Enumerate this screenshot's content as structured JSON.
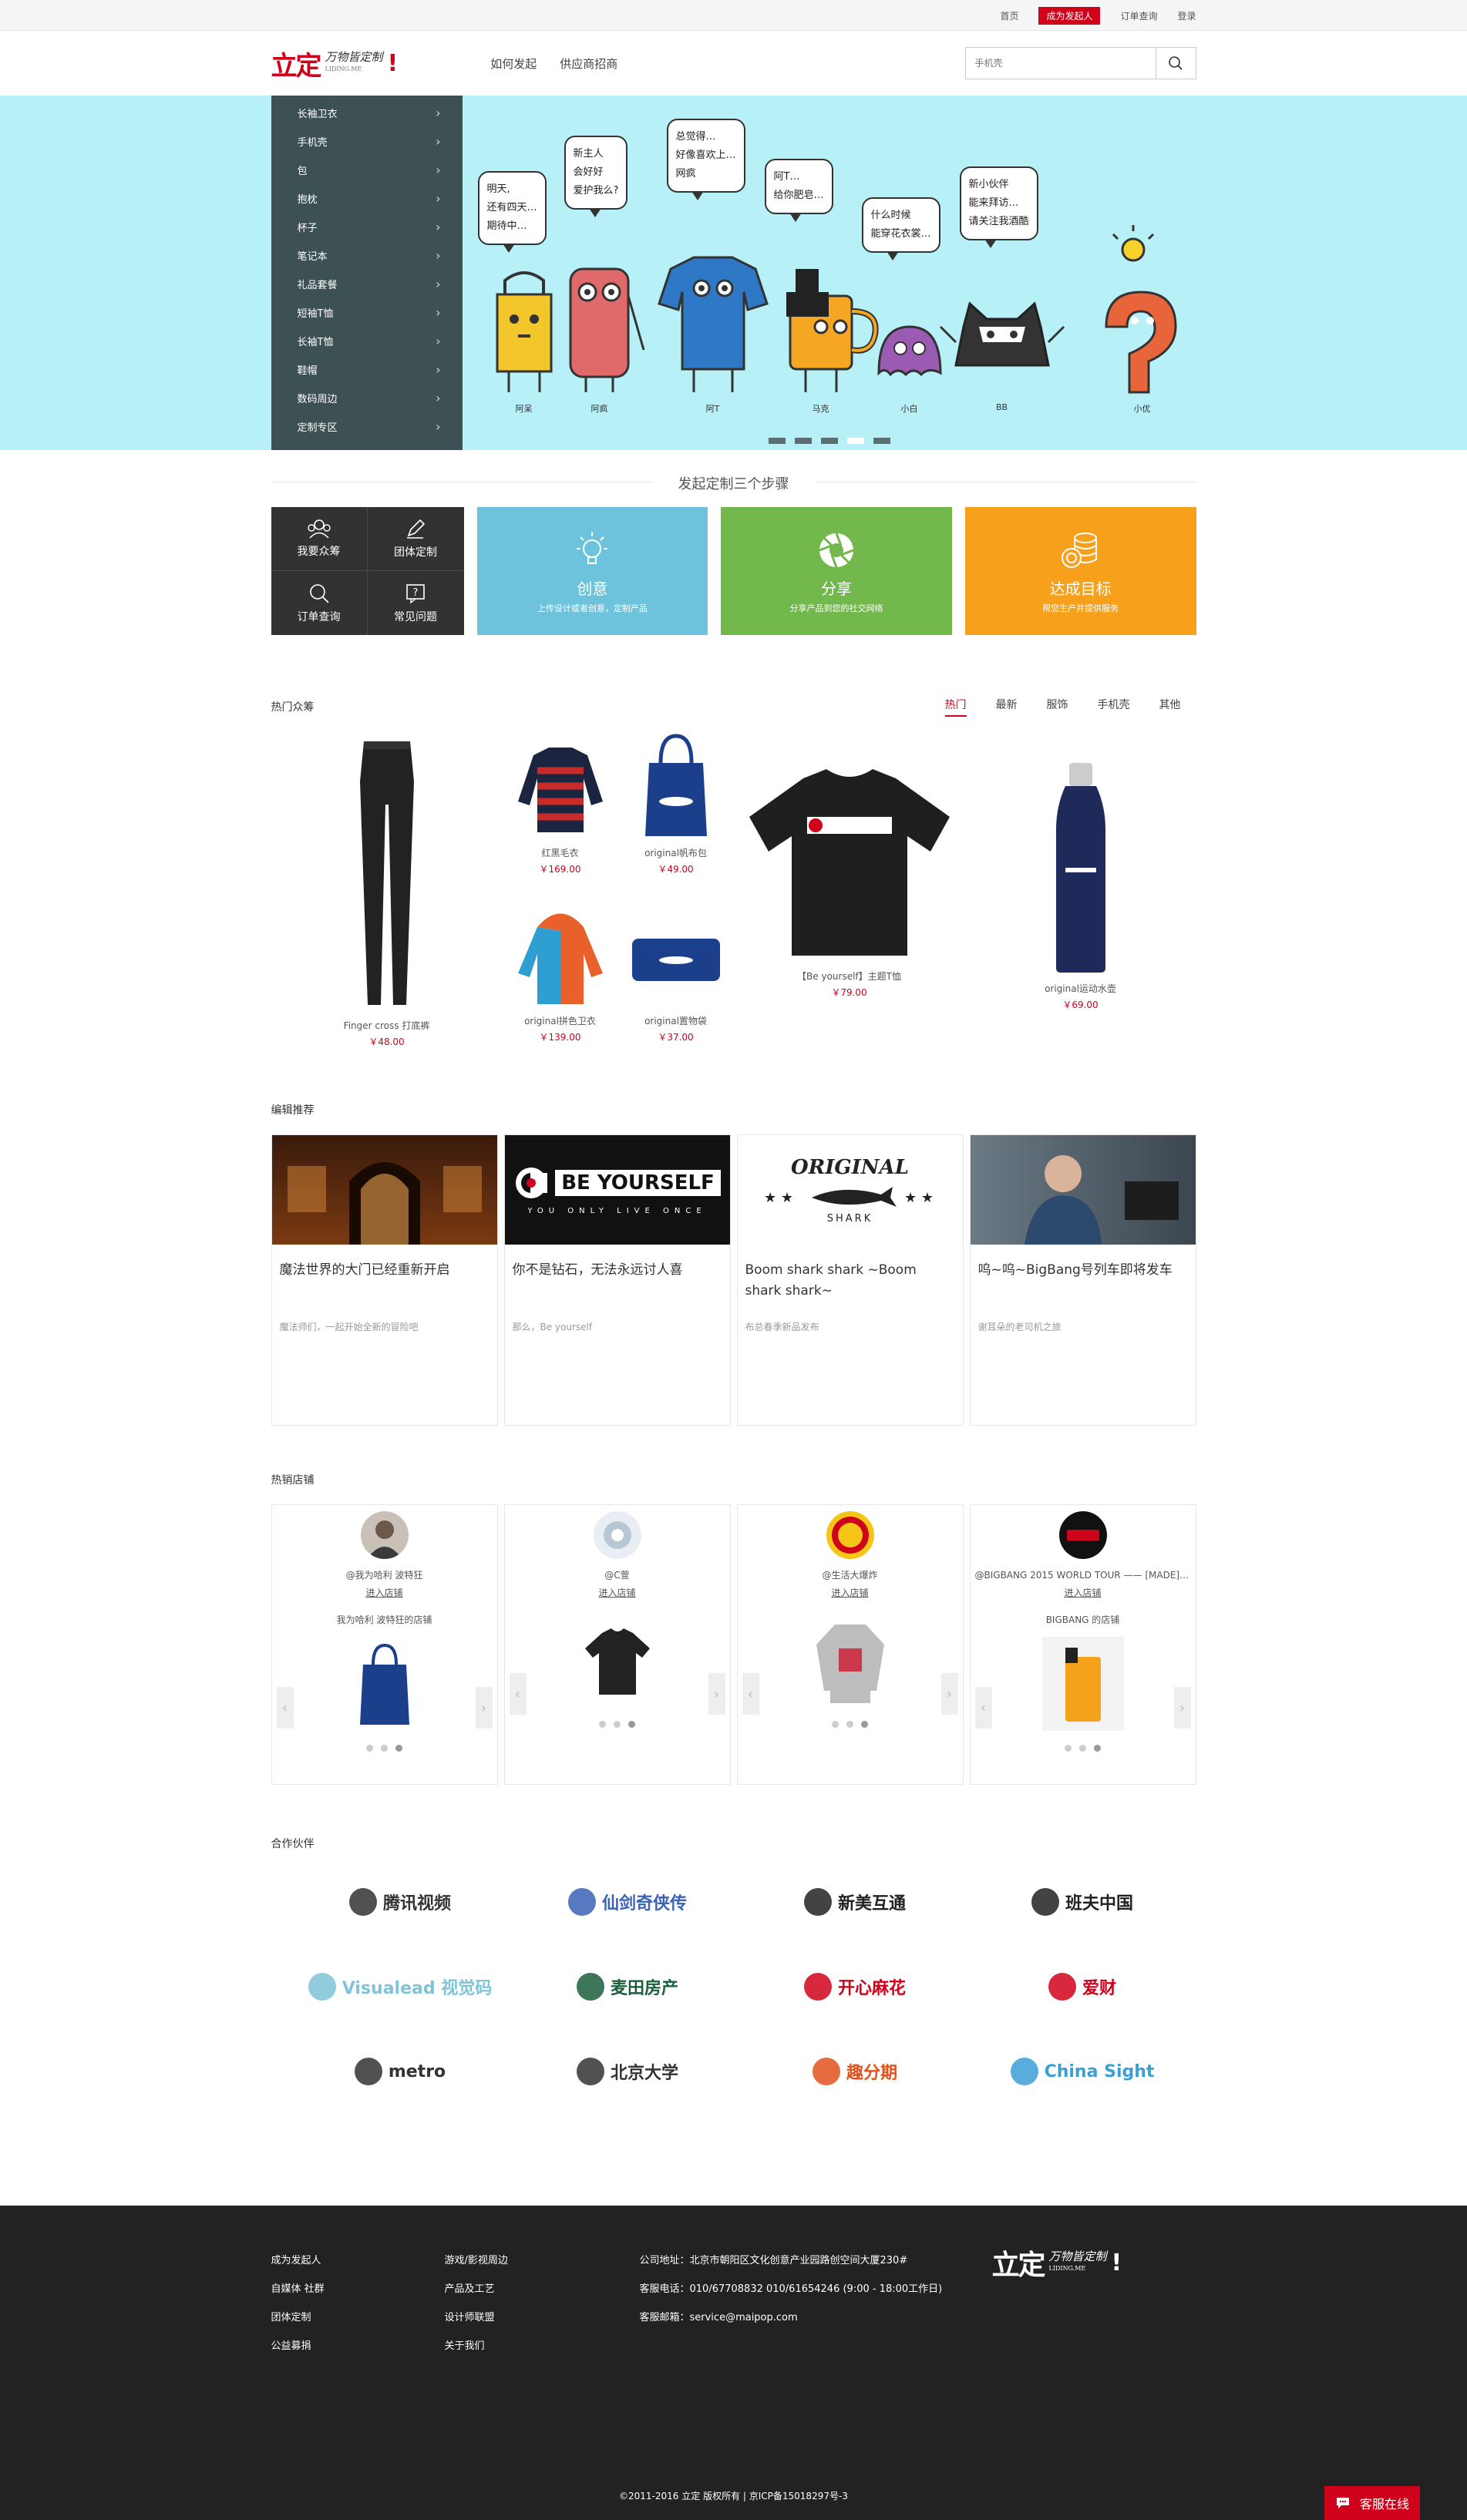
{
  "topbar": {
    "home": "首页",
    "become": "成为发起人",
    "orders": "订单查询",
    "login": "登录"
  },
  "header": {
    "logo_main": "立定",
    "logo_sub": "万物皆定制",
    "logo_url": "LIDING.ME",
    "nav": [
      "如何发起",
      "供应商招商"
    ],
    "search_placeholder": "手机壳"
  },
  "categories": [
    "长袖卫衣",
    "手机壳",
    "包",
    "抱枕",
    "杯子",
    "笔记本",
    "礼品套餐",
    "短袖T恤",
    "长袖T恤",
    "鞋帽",
    "数码周边",
    "定制专区"
  ],
  "banner": {
    "bubbles": [
      [
        "明天,",
        "还有四天…",
        "期待中…"
      ],
      [
        "新主人",
        "会好好",
        "爱护我么?"
      ],
      [
        "总觉得…",
        "好像喜欢上…",
        "网疯"
      ],
      [
        "阿T…",
        "给你肥皂…"
      ],
      [
        "什么时候",
        "能穿花衣裳…"
      ],
      [
        "新小伙伴",
        "能来拜访…",
        "请关注我酒酷"
      ]
    ],
    "characters": [
      "阿呆",
      "阿疯",
      "阿T",
      "马克",
      "小白",
      "BB",
      "小优"
    ],
    "slides": 5,
    "active_slide": 4
  },
  "steps": {
    "title": "发起定制三个步骤",
    "quick": [
      "我要众筹",
      "团体定制",
      "订单查询",
      "常见问题"
    ],
    "items": [
      {
        "title": "创意",
        "desc": "上传设计或者创意，定制产品",
        "color": "#6cc3db"
      },
      {
        "title": "分享",
        "desc": "分享产品到您的社交网络",
        "color": "#72b84c"
      },
      {
        "title": "达成目标",
        "desc": "帮您生产并提供服务",
        "color": "#f6a01c"
      }
    ]
  },
  "hot": {
    "title": "热门众筹",
    "tabs": [
      "热门",
      "最新",
      "服饰",
      "手机壳",
      "其他"
    ],
    "products": [
      {
        "name": "Finger cross 打底裤",
        "price": "￥48.00"
      },
      {
        "name": "红黑毛衣",
        "price": "￥169.00"
      },
      {
        "name": "original帆布包",
        "price": "￥49.00"
      },
      {
        "name": "original拼色卫衣",
        "price": "￥139.00"
      },
      {
        "name": "original置物袋",
        "price": "￥37.00"
      },
      {
        "name": "【Be yourself】主题T恤",
        "price": "￥79.00"
      },
      {
        "name": "original运动水壶",
        "price": "￥69.00"
      }
    ]
  },
  "editor": {
    "title": "编辑推荐",
    "cards": [
      {
        "title": "魔法世界的大门已经重新开启",
        "desc": "魔法师们，一起开始全新的冒险吧"
      },
      {
        "title": "你不是钻石，无法永远讨人喜",
        "desc": "那么，Be yourself"
      },
      {
        "title": "Boom shark shark ~Boom shark shark~",
        "desc": "布总春季新品发布"
      },
      {
        "title": "呜~呜~BigBang号列车即将发车",
        "desc": "谢耳朵的老司机之旅"
      }
    ],
    "img_text": {
      "be_yourself": "BE YOURSELF",
      "be_sub": "YOU ONLY LIVE ONCE",
      "original": "ORIGINAL",
      "shark": "SHARK"
    }
  },
  "shops": {
    "title": "热销店铺",
    "items": [
      {
        "user": "@我为哈利 波特狂",
        "enter": "进入店铺",
        "shop": "我为哈利 波特狂的店铺"
      },
      {
        "user": "@C萱",
        "enter": "进入店铺",
        "shop": ""
      },
      {
        "user": "@生活大爆炸",
        "enter": "进入店铺",
        "shop": ""
      },
      {
        "user": "@BIGBANG 2015 WORLD TOUR —— [MADE] 冒…",
        "enter": "进入店铺",
        "shop": "BIGBANG 的店铺"
      }
    ]
  },
  "partners": {
    "title": "合作伙伴",
    "logos": [
      {
        "name": "腾讯视频",
        "color": "#333"
      },
      {
        "name": "仙剑奇侠传",
        "color": "#3a62b5"
      },
      {
        "name": "新美互通",
        "color": "#222"
      },
      {
        "name": "班夫中国",
        "color": "#222"
      },
      {
        "name": "Visualead 视觉码",
        "color": "#7ec3d6"
      },
      {
        "name": "麦田房产",
        "color": "#1b5e3b"
      },
      {
        "name": "开心麻花",
        "color": "#d0021b"
      },
      {
        "name": "爱财",
        "color": "#d0021b"
      },
      {
        "name": "metro",
        "color": "#333"
      },
      {
        "name": "北京大学",
        "color": "#333"
      },
      {
        "name": "趣分期",
        "color": "#e0521c"
      },
      {
        "name": "China Sight",
        "color": "#3b9fd6"
      }
    ]
  },
  "footer": {
    "col1": [
      "成为发起人",
      "自媒体 社群",
      "团体定制",
      "公益募捐"
    ],
    "col2": [
      "游戏/影视周边",
      "产品及工艺",
      "设计师联盟",
      "关于我们"
    ],
    "address": "公司地址：北京市朝阳区文化创意产业园路创空间大厦230#",
    "phone": "客服电话：010/67708832 010/61654246 (9:00 - 18:00工作日)",
    "email": "客服邮箱：service@maipop.com",
    "copyright": "©2011-2016 立定 版权所有 | 京ICP备15018297号-3"
  },
  "kefu": "客服在线"
}
